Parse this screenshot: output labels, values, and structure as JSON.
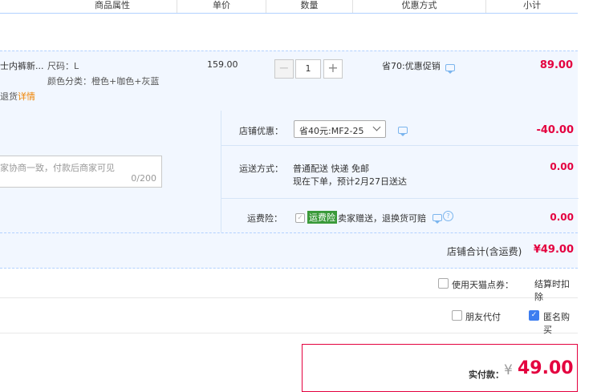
{
  "header": {
    "col_attr": "商品属性",
    "col_price": "单价",
    "col_qty": "数量",
    "col_promo": "优惠方式",
    "col_subtotal": "小计"
  },
  "item": {
    "name": "士内裤新...",
    "size": "尺码：L",
    "color": "颜色分类：橙色+咖色+灰蓝",
    "return_text": "退货",
    "detail_link": "详情",
    "price": "159.00",
    "qty": "1",
    "promo": "省70:优惠促销",
    "subtotal": "89.00"
  },
  "store": {
    "discount_label": "店铺优惠：",
    "discount_select": "省40元:MF2-25",
    "discount_amount": "-40.00",
    "message_placeholder": "家协商一致，付款后商家可见",
    "message_count": "0/200",
    "shipping_label": "运送方式：",
    "shipping_line1": "普通配送 快递 免邮",
    "shipping_line2": "现在下单，预计2月27日送达",
    "shipping_amount": "0.00",
    "insurance_label": "运费险：",
    "insurance_badge": "运费险",
    "insurance_desc": "卖家赠送，退换货可赔",
    "insurance_amount": "0.00",
    "total_label": "店铺合计(含运费)",
    "total_amount": "¥49.00"
  },
  "options": {
    "tmall_points_label": "使用天猫点券：",
    "tmall_points_right": "结算时扣除",
    "friend_pay": "朋友代付",
    "anonymous": "匿名购买"
  },
  "payment": {
    "label": "实付款：",
    "currency": "¥",
    "amount": "49.00"
  },
  "colors": {
    "accent_red": "#e4013f",
    "row_blue": "#f2f7ff",
    "border_blue": "#b2d1ff",
    "badge_green": "#3a9a3a"
  }
}
